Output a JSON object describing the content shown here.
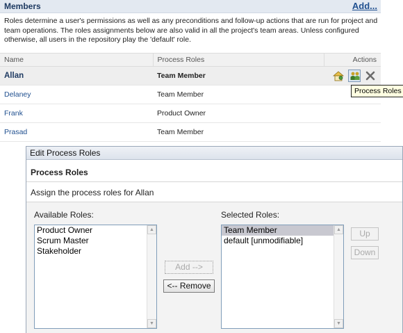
{
  "members": {
    "title": "Members",
    "add_label": "Add...",
    "description": "Roles determine a user's permissions as well as any preconditions and follow-up actions that are run for project and team operations. The roles assignments below are also valid in all the project's team areas. Unless configured otherwise, all users in the repository play the 'default' role.",
    "columns": {
      "name": "Name",
      "roles": "Process Roles",
      "actions": "Actions"
    },
    "rows": [
      {
        "name": "Allan",
        "role": "Team Member"
      },
      {
        "name": "Delaney",
        "role": "Team Member"
      },
      {
        "name": "Frank",
        "role": "Product Owner"
      },
      {
        "name": "Prasad",
        "role": "Team Member"
      }
    ],
    "actions": [
      "process-hierarchy-icon",
      "process-roles-icon",
      "remove-icon"
    ],
    "tooltip": "Process Roles"
  },
  "dialog": {
    "title": "Edit Process Roles",
    "heading": "Process Roles",
    "instruction": "Assign the process roles for Allan",
    "available_label": "Available Roles:",
    "available_roles": [
      "Product Owner",
      "Scrum Master",
      "Stakeholder"
    ],
    "selected_label": "Selected Roles:",
    "selected_roles": [
      "Team Member",
      "default [unmodifiable]"
    ],
    "add_button": "Add -->",
    "remove_button": "<-- Remove",
    "up_button": "Up",
    "down_button": "Down"
  },
  "colors": {
    "link": "#1f4f8f",
    "header_bg": "#e3e9f1",
    "tooltip_bg": "#ffffe1",
    "selection": "#c8c8d0"
  }
}
